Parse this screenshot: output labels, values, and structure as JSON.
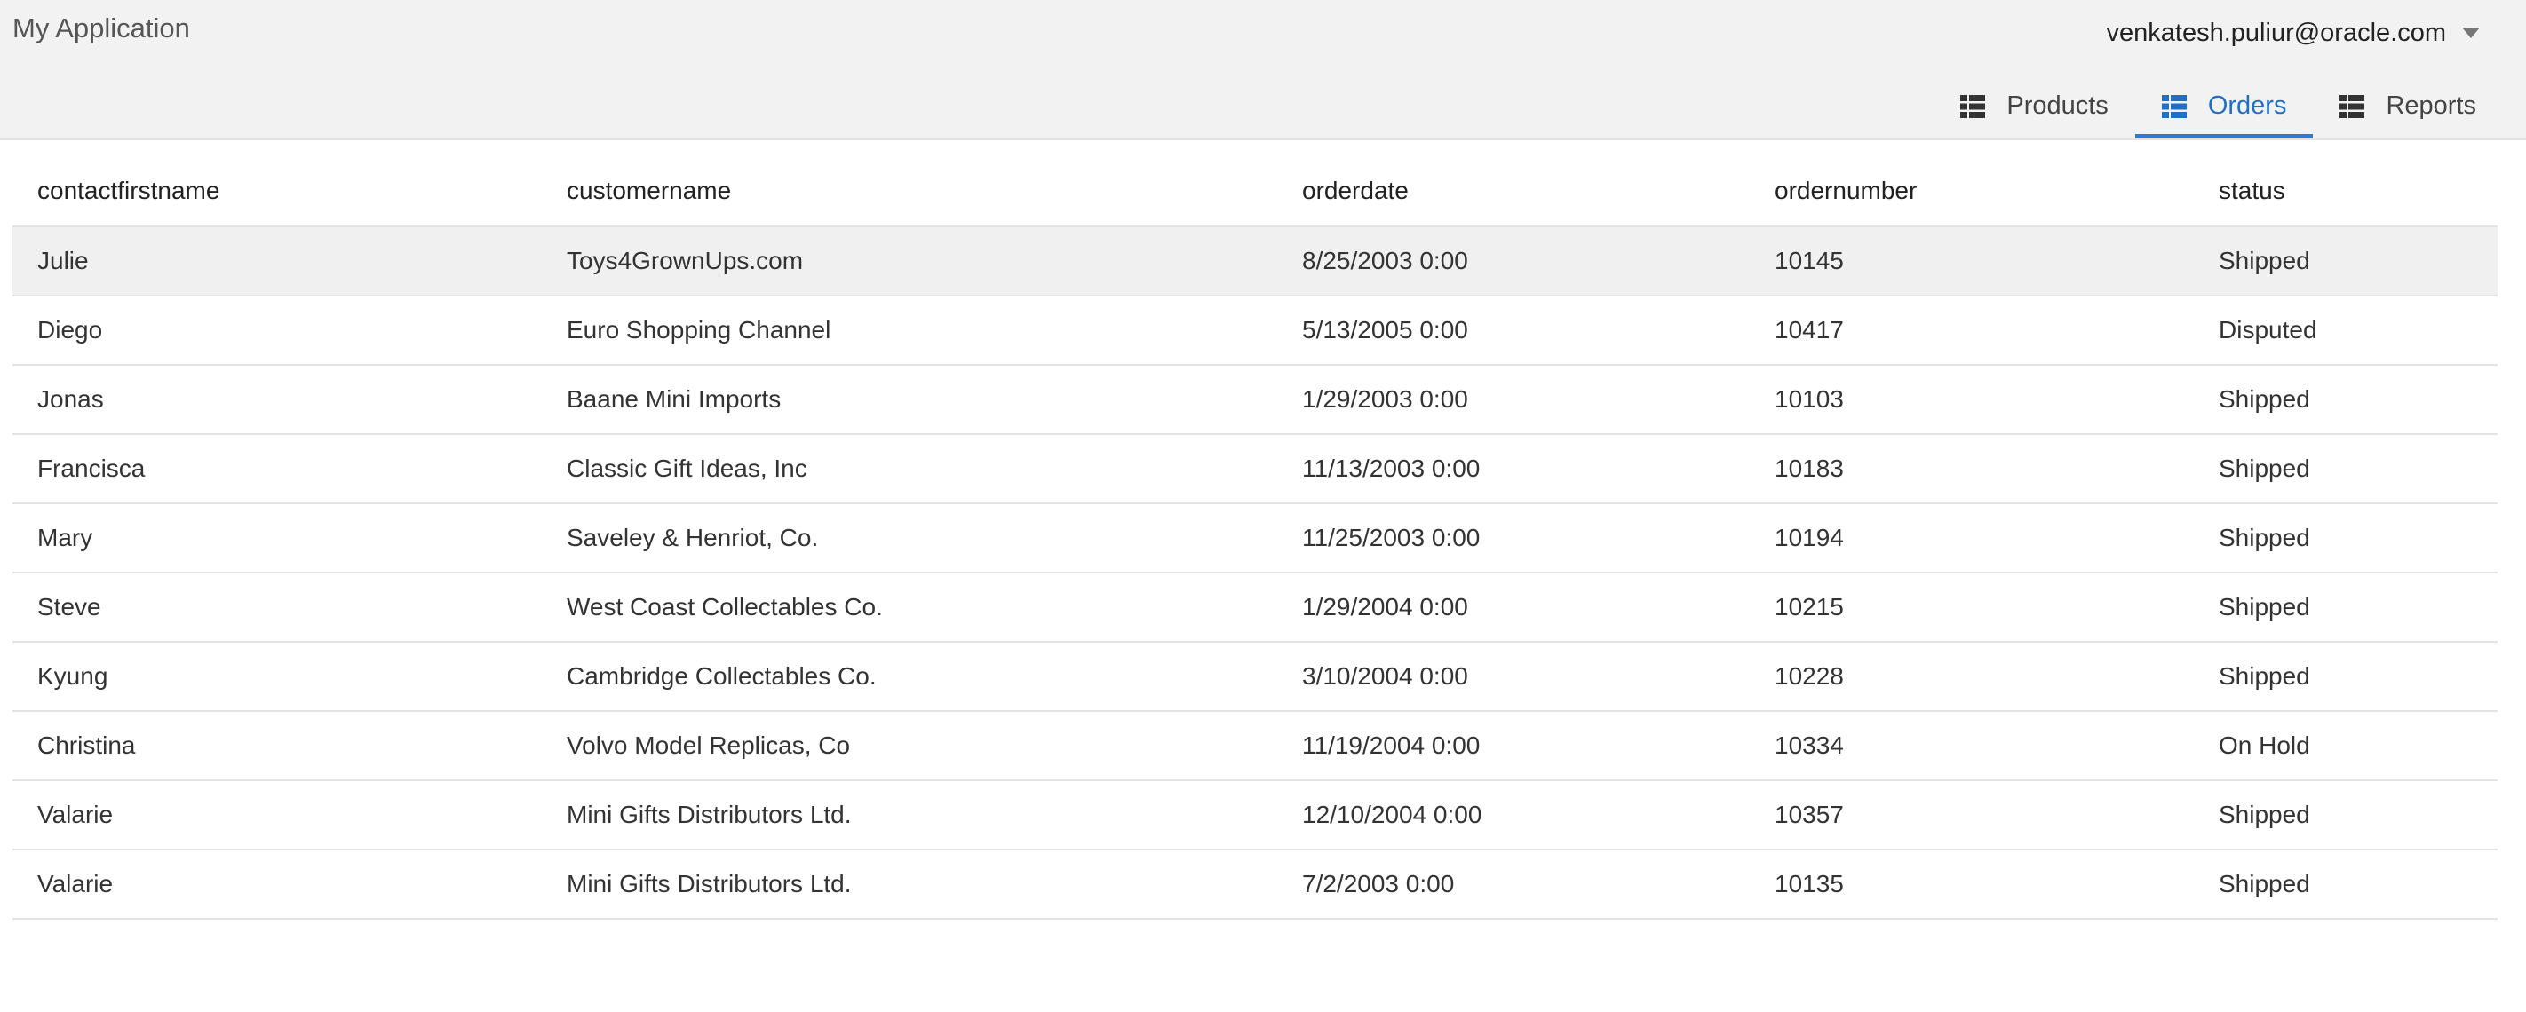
{
  "header": {
    "app_title": "My Application",
    "user_email": "venkatesh.puliur@oracle.com"
  },
  "nav": {
    "tabs": [
      {
        "label": "Products",
        "icon": "table-grid-icon",
        "active": false
      },
      {
        "label": "Orders",
        "icon": "table-grid-icon",
        "active": true
      },
      {
        "label": "Reports",
        "icon": "table-grid-icon",
        "active": false
      }
    ]
  },
  "colors": {
    "accent": "#2e7ad1",
    "header_bg": "#f2f2f2",
    "selected_row_bg": "#f0f0f0"
  },
  "table": {
    "columns": [
      "contactfirstname",
      "customername",
      "orderdate",
      "ordernumber",
      "status"
    ],
    "rows": [
      [
        "Julie",
        "Toys4GrownUps.com",
        "8/25/2003 0:00",
        "10145",
        "Shipped"
      ],
      [
        "Diego",
        "Euro Shopping Channel",
        "5/13/2005 0:00",
        "10417",
        "Disputed"
      ],
      [
        "Jonas",
        "Baane Mini Imports",
        "1/29/2003 0:00",
        "10103",
        "Shipped"
      ],
      [
        "Francisca",
        "Classic Gift Ideas, Inc",
        "11/13/2003 0:00",
        "10183",
        "Shipped"
      ],
      [
        "Mary",
        "Saveley & Henriot, Co.",
        "11/25/2003 0:00",
        "10194",
        "Shipped"
      ],
      [
        "Steve",
        "West Coast Collectables Co.",
        "1/29/2004 0:00",
        "10215",
        "Shipped"
      ],
      [
        "Kyung",
        "Cambridge Collectables Co.",
        "3/10/2004 0:00",
        "10228",
        "Shipped"
      ],
      [
        "Christina",
        "Volvo Model Replicas, Co",
        "11/19/2004 0:00",
        "10334",
        "On Hold"
      ],
      [
        "Valarie",
        "Mini Gifts Distributors Ltd.",
        "12/10/2004 0:00",
        "10357",
        "Shipped"
      ],
      [
        "Valarie",
        "Mini Gifts Distributors Ltd.",
        "7/2/2003 0:00",
        "10135",
        "Shipped"
      ]
    ]
  }
}
